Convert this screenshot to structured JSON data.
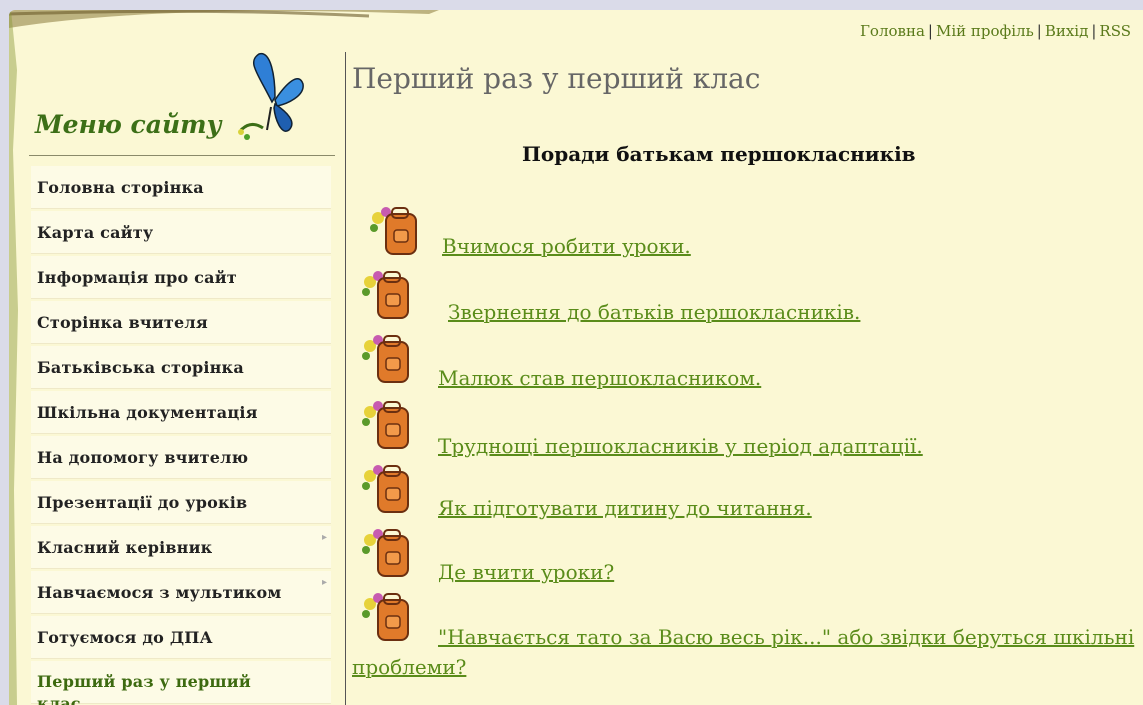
{
  "top_links": {
    "home": "Головна",
    "profile": "Мій профіль",
    "logout": "Вихід",
    "rss": "RSS",
    "separator": "|"
  },
  "sidebar": {
    "title": "Меню сайту",
    "items": [
      {
        "label": "Головна сторінка"
      },
      {
        "label": "Карта сайту"
      },
      {
        "label": "Інформація про сайт"
      },
      {
        "label": "Сторінка вчителя"
      },
      {
        "label": "Батьківська сторінка"
      },
      {
        "label": "Шкільна документація"
      },
      {
        "label": "На допомогу вчителю"
      },
      {
        "label": "Презентації до уроків"
      },
      {
        "label": "Класний керівник"
      },
      {
        "label": "Навчаємося з мультиком"
      },
      {
        "label": "Готуємося до ДПА"
      },
      {
        "label": "Перший раз у перший клас"
      }
    ]
  },
  "main": {
    "page_title": "Перший раз у перший клас",
    "subtitle": "Поради батькам першокласників",
    "links": [
      {
        "text": "Вчимося робити уроки."
      },
      {
        "text": "Звернення до батьків першокласників."
      },
      {
        "text": "Малюк став першокласником."
      },
      {
        "text": "Труднощі першокласників у період адаптації."
      },
      {
        "text": "Як підготувати дитину до читання."
      },
      {
        "text": "Де вчити уроки?"
      },
      {
        "text": "\"Навчається тато за Васю весь рік...\" або звідки беруться шкільні проблеми?"
      }
    ]
  },
  "colors": {
    "page_bg": "#fbf8d4",
    "link": "#5a8c1a",
    "menu_title": "#3c6f17"
  }
}
